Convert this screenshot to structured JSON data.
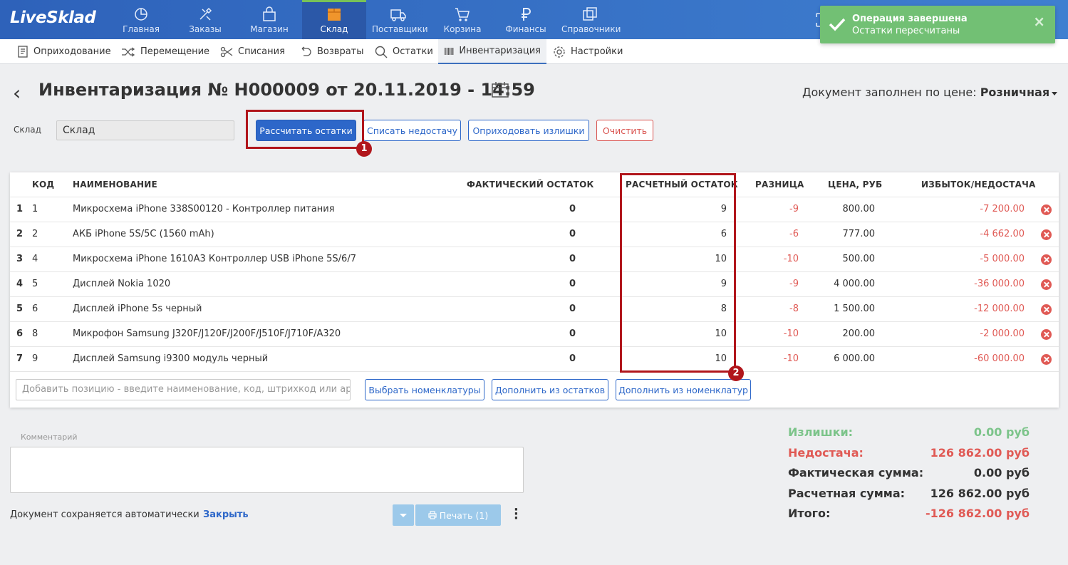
{
  "app": {
    "logo": "LiveSklad"
  },
  "nav": [
    {
      "label": "Главная",
      "icon": "pie-chart-icon"
    },
    {
      "label": "Заказы",
      "icon": "tools-icon"
    },
    {
      "label": "Магазин",
      "icon": "shopping-bag-icon"
    },
    {
      "label": "Склад",
      "icon": "box-icon"
    },
    {
      "label": "Поставщики",
      "icon": "truck-icon"
    },
    {
      "label": "Корзина",
      "icon": "cart-icon"
    },
    {
      "label": "Финансы",
      "icon": "ruble-icon"
    },
    {
      "label": "Справочники",
      "icon": "books-icon"
    }
  ],
  "subnav": [
    {
      "label": "Оприходование",
      "icon": "document-icon"
    },
    {
      "label": "Перемещение",
      "icon": "shuffle-icon"
    },
    {
      "label": "Списания",
      "icon": "scissors-icon"
    },
    {
      "label": "Возвраты",
      "icon": "return-icon"
    },
    {
      "label": "Остатки",
      "icon": "search-icon"
    },
    {
      "label": "Инвентаризация",
      "icon": "barcode-icon"
    },
    {
      "label": "Настройки",
      "icon": "gear-icon"
    }
  ],
  "toast": {
    "title": "Операция завершена",
    "message": "Остатки пересчитаны",
    "close": "×"
  },
  "header": {
    "back": "‹",
    "title": "Инвентаризация № Н000009 от 20.11.2019 - 14:59",
    "price_label": "Документ заполнен по цене:",
    "price_value": "Розничная"
  },
  "toolbar": {
    "sklad_label": "Склад",
    "sklad_value": "Склад",
    "recalc": "Рассчитать остатки",
    "writeoff": "Списать недостачу",
    "receive": "Оприходовать излишки",
    "clear": "Очистить"
  },
  "badges": {
    "one": "1",
    "two": "2"
  },
  "table": {
    "headers": [
      "КОД",
      "НАИМЕНОВАНИЕ",
      "ФАКТИЧЕСКИЙ ОСТАТОК",
      "РАСЧЕТНЫЙ ОСТАТОК",
      "РАЗНИЦА",
      "ЦЕНА, РУБ",
      "ИЗБЫТОК/НЕДОСТАЧА"
    ],
    "rows": [
      {
        "n": "1",
        "code": "1",
        "name": "Микросхема iPhone 338S00120 - Контроллер питания",
        "fact": "0",
        "calc": "9",
        "diff": "-9",
        "price": "800.00",
        "delta": "-7 200.00"
      },
      {
        "n": "2",
        "code": "2",
        "name": "АКБ iPhone 5S/5C (1560 mAh)",
        "fact": "0",
        "calc": "6",
        "diff": "-6",
        "price": "777.00",
        "delta": "-4 662.00"
      },
      {
        "n": "3",
        "code": "4",
        "name": "Микросхема iPhone 1610A3 Контроллер USB iPhone 5S/6/7",
        "fact": "0",
        "calc": "10",
        "diff": "-10",
        "price": "500.00",
        "delta": "-5 000.00"
      },
      {
        "n": "4",
        "code": "5",
        "name": "Дисплей Nokia 1020",
        "fact": "0",
        "calc": "9",
        "diff": "-9",
        "price": "4 000.00",
        "delta": "-36 000.00"
      },
      {
        "n": "5",
        "code": "6",
        "name": "Дисплей iPhone 5s черный",
        "fact": "0",
        "calc": "8",
        "diff": "-8",
        "price": "1 500.00",
        "delta": "-12 000.00"
      },
      {
        "n": "6",
        "code": "8",
        "name": "Микрофон Samsung J320F/J120F/J200F/J510F/J710F/A320",
        "fact": "0",
        "calc": "10",
        "diff": "-10",
        "price": "200.00",
        "delta": "-2 000.00"
      },
      {
        "n": "7",
        "code": "9",
        "name": "Дисплей Samsung i9300 модуль черный",
        "fact": "0",
        "calc": "10",
        "diff": "-10",
        "price": "6 000.00",
        "delta": "-60 000.00"
      }
    ],
    "add_placeholder": "Добавить позицию - введите наименование, код, штрихкод или артикул",
    "pick_nomen": "Выбрать номенклатуры",
    "fill_stock": "Дополнить из остатков",
    "fill_nomen": "Дополнить из номенклатур"
  },
  "footer": {
    "comment_label": "Комментарий",
    "autosave": "Документ сохраняется автоматически",
    "close": "Закрыть",
    "print": "Печать (1)"
  },
  "summary": [
    {
      "label": "Излишки:",
      "value": "0.00 руб",
      "color": "#7cc48a"
    },
    {
      "label": "Недостача:",
      "value": "126 862.00 руб",
      "color": "#e05a55"
    },
    {
      "label": "Фактическая сумма:",
      "value": "0.00 руб",
      "color": "#333333"
    },
    {
      "label": "Расчетная сумма:",
      "value": "126 862.00 руб",
      "color": "#333333"
    },
    {
      "label": "Итого:",
      "value": "-126 862.00 руб",
      "color": "#e05a55"
    }
  ],
  "colors": {
    "topbar": "#3a72c6",
    "accent": "#2d67c9",
    "negative": "#e05a55",
    "highlight": "#b1161c",
    "toast": "#72c074"
  }
}
